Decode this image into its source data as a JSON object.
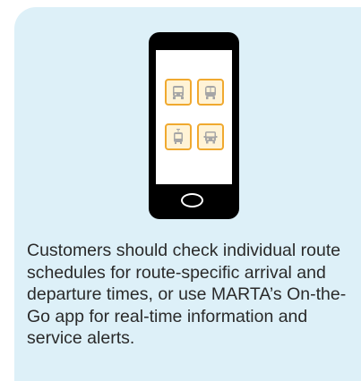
{
  "illustration": {
    "device": "smartphone",
    "app_icons": [
      "bus-icon",
      "train-icon",
      "streetcar-icon",
      "mobility-van-icon"
    ],
    "colors": {
      "background": "#ddf0f8",
      "phone": "#000000",
      "icon_border": "#f0a92f",
      "icon_fill": "#fff3d6",
      "icon_glyph": "#a6a6a6"
    }
  },
  "caption": "Customers should check individual route schedules for route-specific arrival and departure times, or use MARTA’s On-the-Go app for real-time information and service alerts."
}
